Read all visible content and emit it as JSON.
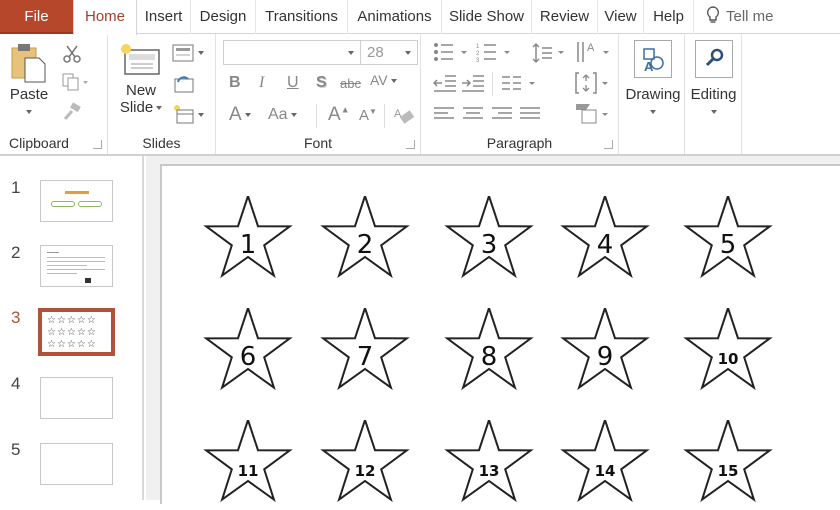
{
  "tabs": {
    "file": "File",
    "home": "Home",
    "insert": "Insert",
    "design": "Design",
    "transitions": "Transitions",
    "animations": "Animations",
    "slideshow": "Slide Show",
    "review": "Review",
    "view": "View",
    "help": "Help",
    "tell_me": "Tell me"
  },
  "ribbon": {
    "clipboard": {
      "label": "Clipboard",
      "paste": "Paste"
    },
    "slides": {
      "label": "Slides",
      "new_slide_1": "New",
      "new_slide_2": "Slide"
    },
    "font": {
      "label": "Font",
      "font_name": "",
      "font_size": "28",
      "bold": "B",
      "italic": "I",
      "underline": "U",
      "shadow": "S",
      "strike": "abc",
      "spacing": "AV",
      "color": "A",
      "case": "Aa",
      "grow": "A",
      "shrink": "A"
    },
    "paragraph": {
      "label": "Paragraph"
    },
    "drawing": {
      "label": "Drawing"
    },
    "editing": {
      "label": "Editing"
    }
  },
  "thumbnails": [
    {
      "number": "1",
      "type": "title"
    },
    {
      "number": "2",
      "type": "text"
    },
    {
      "number": "3",
      "type": "stars",
      "selected": true
    },
    {
      "number": "4",
      "type": "blank"
    },
    {
      "number": "5",
      "type": "blank"
    }
  ],
  "slide": {
    "stars": [
      "1",
      "2",
      "3",
      "4",
      "5",
      "6",
      "7",
      "8",
      "9",
      "10",
      "11",
      "12",
      "13",
      "14",
      "15"
    ]
  },
  "colors": {
    "accent": "#b7472a",
    "selection": "#b0533a"
  }
}
